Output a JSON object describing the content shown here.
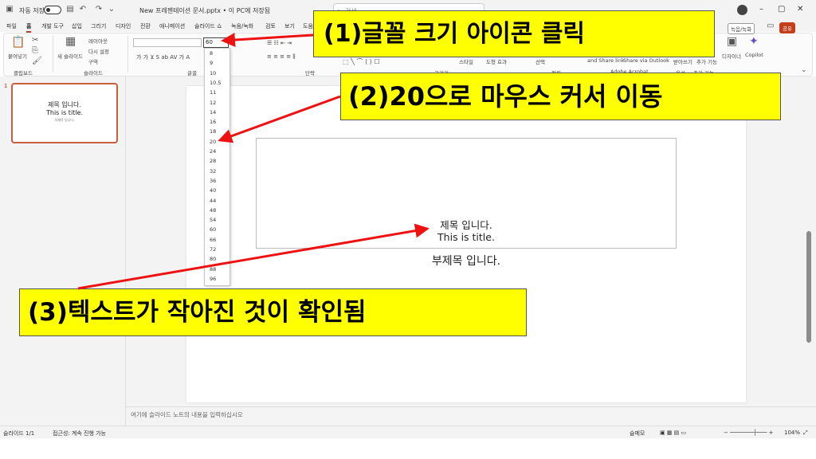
{
  "titlebar": {
    "autosave_label": "자동 저장",
    "autosave_state": "꿈",
    "file_title": "New 프레젠테이션 문서.pptx • 이 PC에 저장됨",
    "search_placeholder": "검색"
  },
  "tabs": [
    "파일",
    "홈",
    "개발 도구",
    "삽입",
    "그리기",
    "디자인",
    "전환",
    "애니메이션",
    "슬라이드 쇼",
    "녹음/녹화",
    "검토",
    "보기",
    "도움"
  ],
  "active_tab": "홈",
  "ribbon": {
    "paste": "붙여넣기",
    "clipboard": "클립보드",
    "new_slide": "새 슬라이드",
    "layout": "레이아웃",
    "reset": "다시 설정",
    "section": "구역",
    "slides_group": "슬라이드",
    "font_size_value": "60",
    "font_group": "글꼴",
    "paragraph_group": "단락",
    "drawing_group": "그리기",
    "arrange": "정렬",
    "style": "스타일",
    "shape_effect": "도형 효과",
    "select": "선택",
    "edit_group": "편집",
    "share_link": "and Share link",
    "share_outlook": "Share via Outlook",
    "adobe": "Adobe Acrobat",
    "dictate": "받아쓰기",
    "voice": "음성",
    "addins": "추가 기능",
    "designer": "디자이너",
    "copilot": "Copilot",
    "record_btn": "녹음/녹화",
    "share_btn": "공유"
  },
  "font_size_options": [
    "8",
    "9",
    "10",
    "10.5",
    "11",
    "12",
    "14",
    "16",
    "18",
    "20",
    "24",
    "28",
    "32",
    "36",
    "40",
    "44",
    "48",
    "54",
    "60",
    "66",
    "72",
    "80",
    "88",
    "96"
  ],
  "thumbnail": {
    "number": "1",
    "title_line1": "제목 입니다.",
    "title_line2": "This is title.",
    "subtitle": "부제목 입니다."
  },
  "slide": {
    "title_line1": "제목 입니다.",
    "title_line2": "This is title.",
    "subtitle": "부제목 입니다."
  },
  "notes_placeholder": "여기에 슬라이드 노트의 내용을 입력하십시오",
  "statusbar": {
    "slide_count": "슬라이드 1/1",
    "accessibility": "접근성: 계속 진행 가능",
    "notes_btn": "슬메모",
    "zoom": "104%"
  },
  "callouts": {
    "step1": "(1)글꼴 크기 아이콘 클릭",
    "step2": "(2)20으로 마우스 커서 이동",
    "step3": "(3)텍스트가 작아진 것이 확인됨"
  },
  "colors": {
    "callout_bg": "#ffff00",
    "arrow": "#ee1111",
    "accent": "#c43e1c"
  }
}
